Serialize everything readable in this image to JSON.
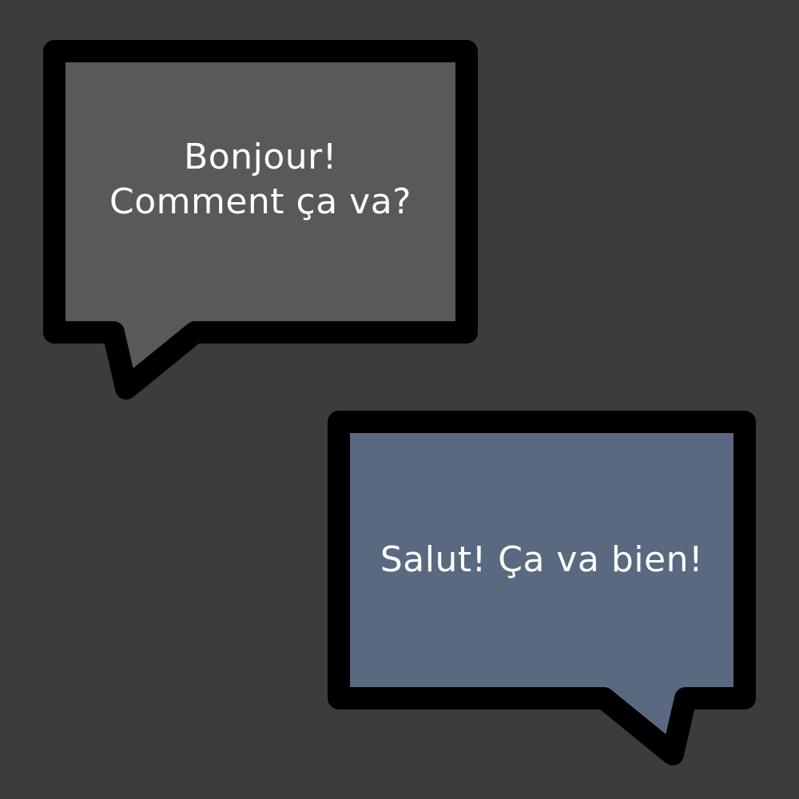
{
  "scene": {
    "background_color": "#3c3c3c"
  },
  "bubbles": [
    {
      "lines": [
        "Bonjour!",
        "Comment ça va?"
      ],
      "fill_color": "#595959",
      "border_color": "#000000"
    },
    {
      "lines": [
        "Salut! Ça va bien!"
      ],
      "fill_color": "#5a6880",
      "border_color": "#000000"
    }
  ]
}
